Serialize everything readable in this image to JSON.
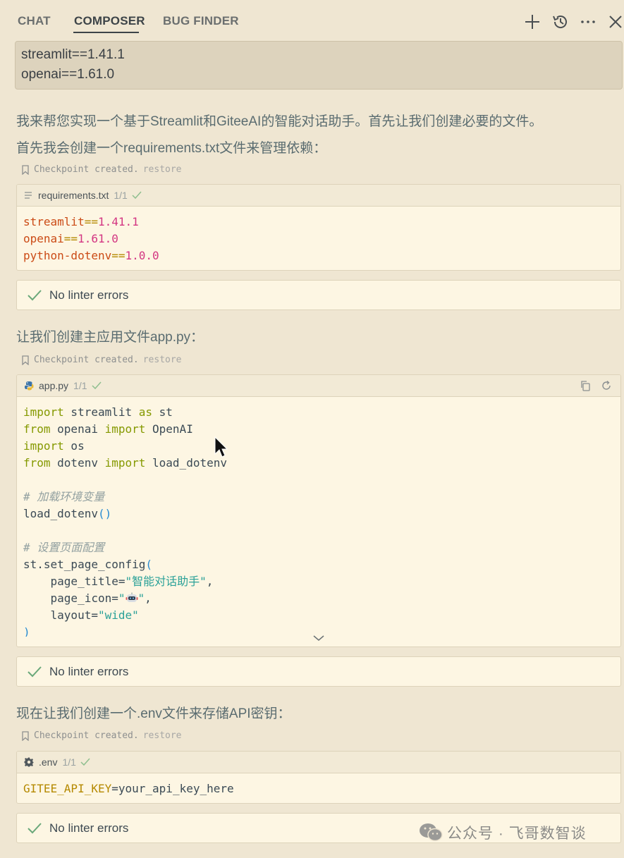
{
  "header": {
    "tabs": [
      {
        "label": "CHAT"
      },
      {
        "label": "COMPOSER"
      },
      {
        "label": "BUG FINDER"
      }
    ],
    "icons": [
      "plus-icon",
      "history-icon",
      "more-icon",
      "close-icon"
    ]
  },
  "top_block": {
    "lines": [
      "streamlit==1.41.1",
      "openai==1.61.0"
    ]
  },
  "messages": {
    "intro1": "我来帮您实现一个基于Streamlit和GiteeAI的智能对话助手。首先让我们创建必要的文件。",
    "intro2": "首先我会创建一个requirements.txt文件来管理依赖：",
    "app_intro": "让我们创建主应用文件app.py：",
    "env_intro": "现在让我们创建一个.env文件来存储API密钥："
  },
  "checkpoint": {
    "text": "Checkpoint created.",
    "restore": "restore"
  },
  "files": {
    "requirements": {
      "name": "requirements.txt",
      "ratio": "1/1",
      "lines": [
        {
          "pkg": "streamlit",
          "ver": "1.41.1"
        },
        {
          "pkg": "openai",
          "ver": "1.61.0"
        },
        {
          "pkg": "python-dotenv",
          "ver": "1.0.0"
        }
      ]
    },
    "app": {
      "name": "app.py",
      "ratio": "1/1",
      "comment1": "# 加载环境变量",
      "comment2": "# 设置页面配置",
      "page_title": "\"智能对话助手\"",
      "layout": "\"wide\""
    },
    "env": {
      "name": ".env",
      "ratio": "1/1",
      "key": "GITEE_API_KEY",
      "value": "your_api_key_here"
    }
  },
  "lint_text": "No linter errors",
  "watermark": "公众号 · 飞哥数智谈"
}
